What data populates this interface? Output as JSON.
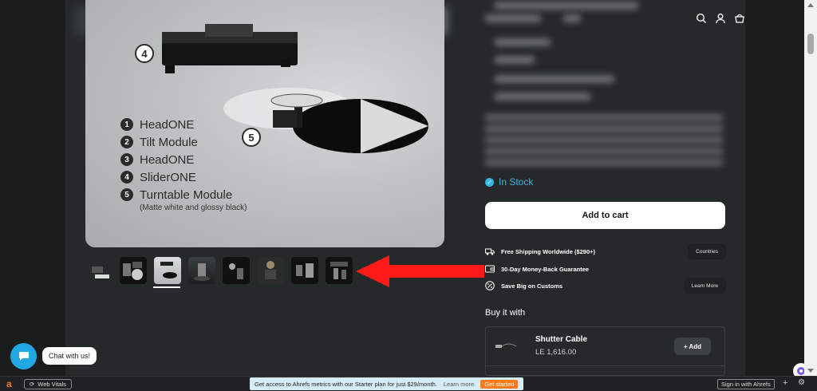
{
  "header": {
    "icons": [
      "search-icon",
      "account-icon",
      "cart-icon"
    ]
  },
  "hero": {
    "badge_4": "4",
    "badge_5": "5",
    "legend": [
      {
        "num": "1",
        "label": "HeadONE"
      },
      {
        "num": "2",
        "label": "Tilt Module"
      },
      {
        "num": "3",
        "label": "HeadONE"
      },
      {
        "num": "4",
        "label": "SliderONE"
      },
      {
        "num": "5",
        "label": "Turntable Module"
      }
    ],
    "note": "(Matte white and glossy black)"
  },
  "thumbnails": {
    "count": 8,
    "active_index": 2
  },
  "product": {
    "stock": "In Stock",
    "add_to_cart": "Add to cart",
    "perks": [
      {
        "icon": "truck-icon",
        "text": "Free Shipping Worldwide ($290+)",
        "button": "Countries"
      },
      {
        "icon": "wallet-icon",
        "text": "30-Day Money-Back Guarantee",
        "button": ""
      },
      {
        "icon": "percent-icon",
        "text": "Save Big on Customs",
        "button": "Learn More"
      }
    ],
    "buy_it_with": "Buy it with",
    "addon": {
      "name": "Shutter Cable",
      "price": "LE 1,616.00",
      "add": "+ Add"
    }
  },
  "chat": {
    "label": "Chat with us!"
  },
  "ahrefs_bar": {
    "logo": "a",
    "web_vitals": "Web Vitals",
    "promo": "Get access to Ahrefs metrics with our Starter plan for just $29/month.",
    "learn_more": "Learn more",
    "get_started": "Get started",
    "sign_in": "Sign in with Ahrefs",
    "plus": "+",
    "settings": "⚙"
  },
  "colors": {
    "accent": "#36b6e6",
    "arrow": "#ff1a1a",
    "ahrefs_orange": "#ff7a1a"
  }
}
